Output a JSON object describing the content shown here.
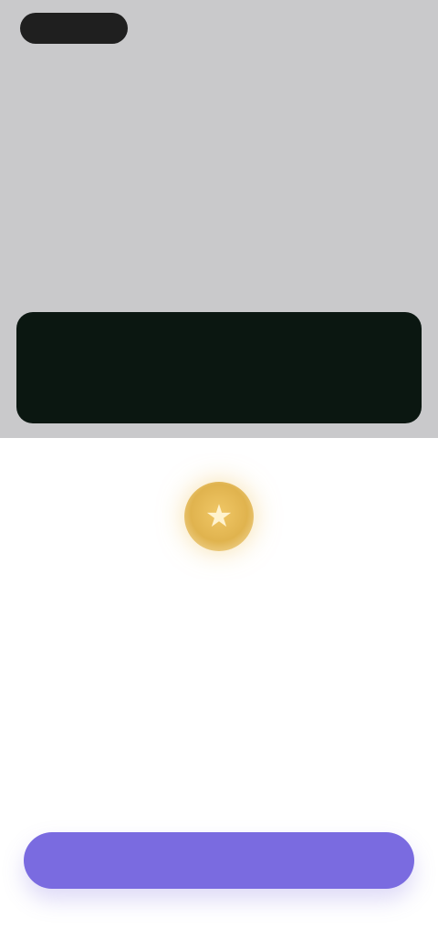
{
  "header": {
    "logo_text": "",
    "right_text": ""
  },
  "hero": {
    "headline": "",
    "card_label": ""
  },
  "achievement": {
    "icon": "medal-icon",
    "title": "",
    "subtitle": ""
  },
  "cta": {
    "label": ""
  },
  "colors": {
    "top_background": "#c9c9cb",
    "dark_card": "#0b1711",
    "accent_purple": "#7a6be0",
    "medal_gold": "#e0b34e"
  }
}
